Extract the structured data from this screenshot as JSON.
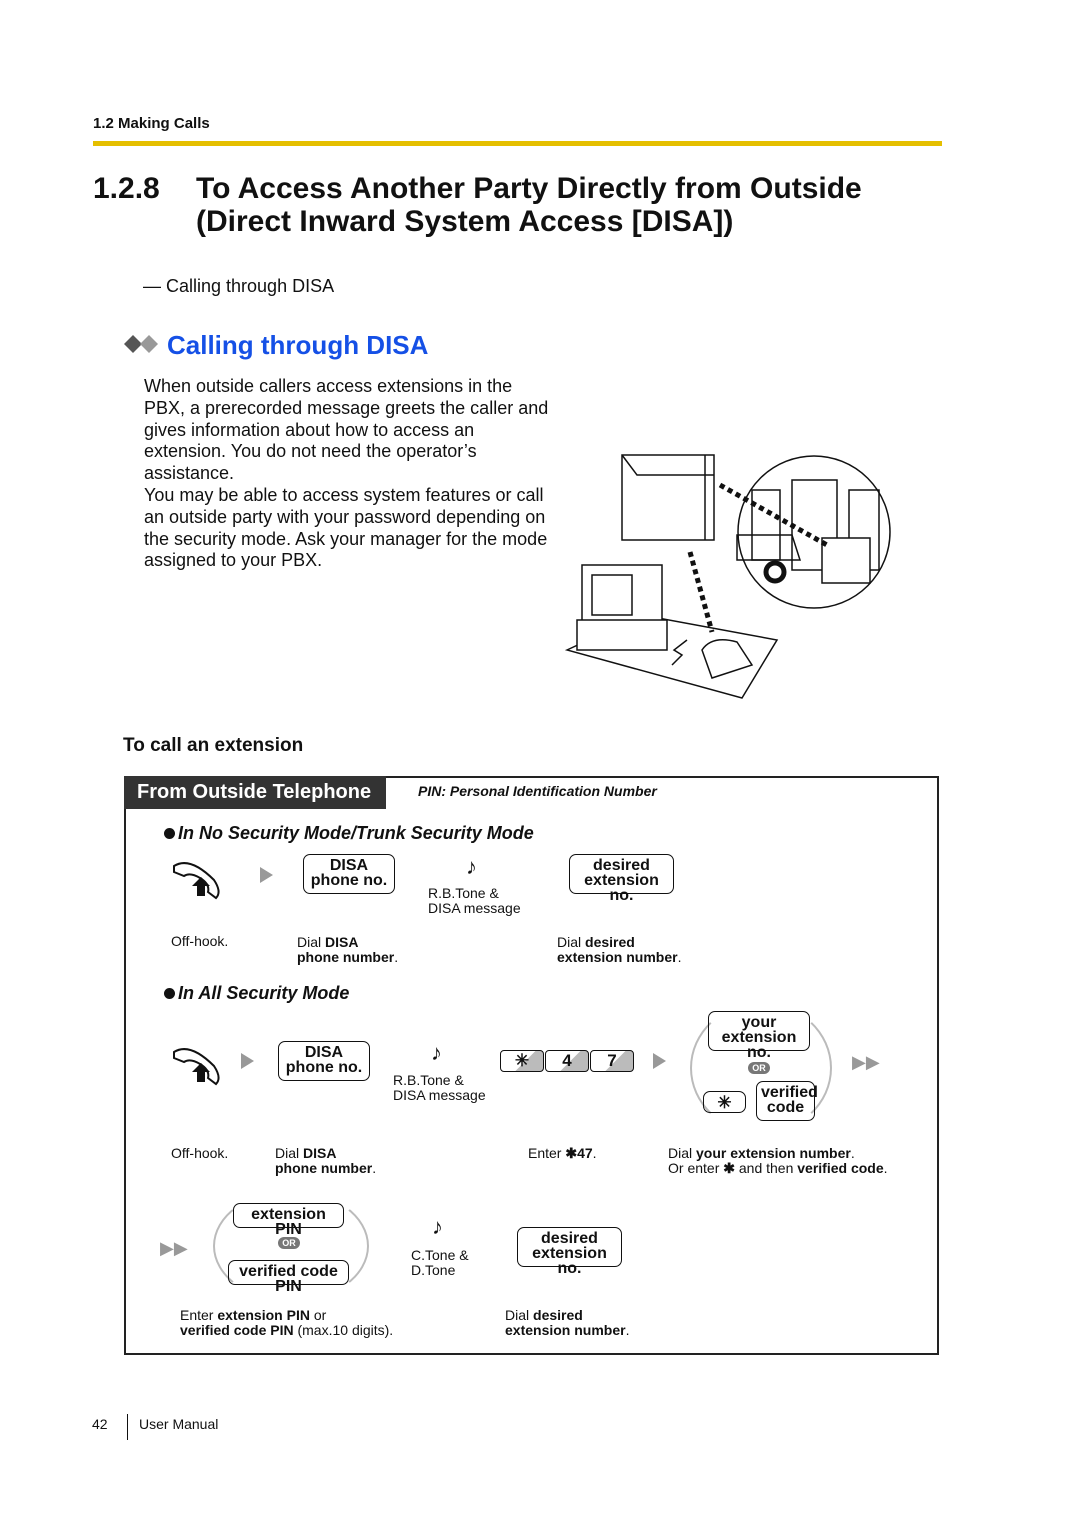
{
  "header": {
    "section": "1.2 Making Calls"
  },
  "title": {
    "number": "1.2.8",
    "text": "To Access Another Party Directly from Outside (Direct Inward System Access [DISA])"
  },
  "toc": {
    "item": "— Calling through DISA"
  },
  "section": {
    "heading": "Calling through DISA",
    "paragraph": "When outside callers access extensions in the PBX, a prerecorded message greets the caller and gives information about how to access an extension. You do not need the operator’s assistance.",
    "paragraph2": "You may be able to access system features or call an outside party with your password depending on the security mode. Ask your manager for the mode assigned to your PBX."
  },
  "procedure": {
    "heading": "To call an extension",
    "tab": "From Outside Telephone",
    "pin_note": "PIN: Personal Identification Number",
    "mode1": {
      "title": "In No Security Mode/Trunk Security Mode",
      "key_disa": [
        "DISA",
        "phone no."
      ],
      "tone": [
        "R.B.Tone &",
        "DISA message"
      ],
      "key_ext": [
        "desired",
        "extension no."
      ],
      "cap_offhook": "Off-hook.",
      "cap_dial": {
        "a": "Dial ",
        "b": "DISA",
        "c": "phone number",
        "d": "."
      },
      "cap_ext": {
        "a": "Dial ",
        "b": "desired",
        "c": "extension number",
        "d": "."
      }
    },
    "mode2": {
      "title": "In All Security Mode",
      "key_disa": [
        "DISA",
        "phone no."
      ],
      "tone": [
        "R.B.Tone &",
        "DISA message"
      ],
      "keys": [
        "✳",
        "4",
        "7"
      ],
      "key_your": [
        "your",
        "extension no."
      ],
      "or": "OR",
      "key_star": "✳",
      "key_verified": [
        "verified",
        "code"
      ],
      "cap_offhook": "Off-hook.",
      "cap_dial": {
        "a": "Dial ",
        "b": "DISA",
        "c": "phone number",
        "d": "."
      },
      "cap_enter": {
        "a": "Enter ",
        "b": "✱47",
        "c": "."
      },
      "cap_your": {
        "a": "Dial ",
        "b": "your extension number",
        "c": ".",
        "d": "Or enter ",
        "e": "✱",
        "f": " and then ",
        "g": "verified code",
        "h": "."
      },
      "key_extpin": "extension PIN",
      "key_vcpin": "verified code PIN",
      "tone2": [
        "C.Tone &",
        "D.Tone"
      ],
      "key_ext": [
        "desired",
        "extension no."
      ],
      "cap_pin": {
        "a": "Enter ",
        "b": "extension PIN",
        "c": " or",
        "d": "verified code PIN",
        "e": " (max.10 digits)."
      },
      "cap_ext": {
        "a": "Dial ",
        "b": "desired",
        "c": "extension number",
        "d": "."
      }
    }
  },
  "footer": {
    "page": "42",
    "label": "User Manual"
  },
  "colors": {
    "accent_bar": "#e5bf00",
    "heading_blue": "#1550e6",
    "tab_bg": "#333333"
  }
}
